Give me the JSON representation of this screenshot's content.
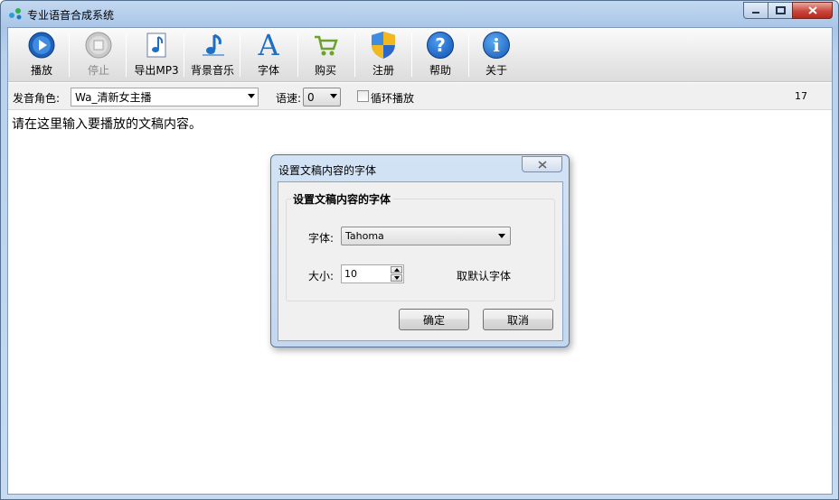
{
  "window": {
    "title": "专业语音合成系统"
  },
  "toolbar": {
    "play": "播放",
    "stop": "停止",
    "export_mp3": "导出MP3",
    "bg_music": "背景音乐",
    "font": "字体",
    "buy": "购买",
    "register": "注册",
    "help": "帮助",
    "about": "关于",
    "font_glyph": "A",
    "help_glyph": "?",
    "about_glyph": "i"
  },
  "options": {
    "voice_label": "发音角色:",
    "voice_value": "Wa_清新女主播",
    "speed_label": "语速:",
    "speed_value": "0",
    "loop_label": "循环播放",
    "loop_checked": false,
    "count": "17"
  },
  "editor": {
    "text": "请在这里输入要播放的文稿内容。"
  },
  "dialog": {
    "title": "设置文稿内容的字体",
    "group_title": "设置文稿内容的字体",
    "font_label": "字体:",
    "font_value": "Tahoma",
    "size_label": "大小:",
    "size_value": "10",
    "default_font_label": "取默认字体",
    "ok": "确定",
    "cancel": "取消"
  },
  "icons": [
    "app-icon",
    "play-icon",
    "stop-icon",
    "music-note-icon",
    "music-note-icon",
    "font-icon",
    "cart-icon",
    "shield-icon",
    "help-icon",
    "info-icon",
    "minimize-icon",
    "maximize-icon",
    "close-icon"
  ],
  "colors": {
    "accent_blue": "#1e6fc2",
    "close_red": "#c9463c"
  }
}
